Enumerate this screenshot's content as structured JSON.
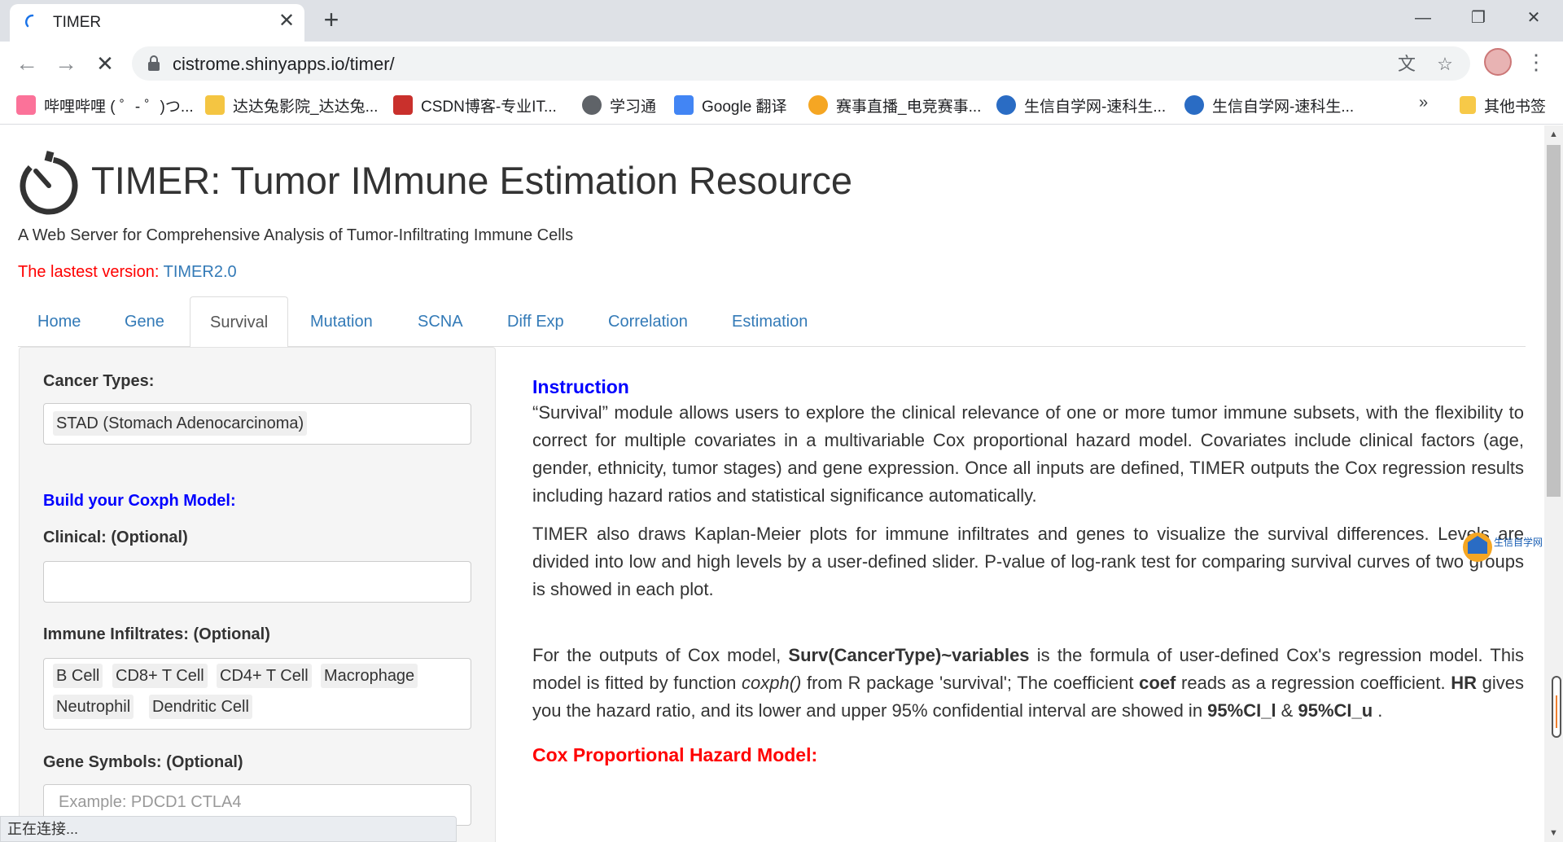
{
  "browser": {
    "tab_title": "TIMER",
    "tab_close": "✕",
    "new_tab": "+",
    "url": "cistrome.shinyapps.io/timer/",
    "win_minimize": "—",
    "win_restore": "❐",
    "win_close": "✕",
    "bookmarks": [
      {
        "label": "哔哩哔哩 ( ゜- ゜)つ...",
        "icon": "bilibili-icon",
        "color": "#fb7299"
      },
      {
        "label": "达达兔影院_达达兔...",
        "icon": "rabbit-icon",
        "color": "#f4c542"
      },
      {
        "label": "CSDN博客-专业IT...",
        "icon": "csdn-icon",
        "color": "#c9302c"
      },
      {
        "label": "学习通",
        "icon": "globe-icon",
        "color": "#5f6368"
      },
      {
        "label": "Google 翻译",
        "icon": "translate-icon",
        "color": "#4285f4"
      },
      {
        "label": "赛事直播_电竞赛事...",
        "icon": "fox-icon",
        "color": "#f5a623"
      },
      {
        "label": "生信自学网-速科生...",
        "icon": "biowolf-icon",
        "color": "#2a6cc4"
      },
      {
        "label": "生信自学网-速科生...",
        "icon": "biowolf-icon",
        "color": "#2a6cc4"
      }
    ],
    "bookmarks_more": "»",
    "other_bookmarks": "其他书签",
    "status_text": "正在连接..."
  },
  "page": {
    "title": "TIMER: Tumor IMmune Estimation Resource",
    "subtitle": "A Web Server for Comprehensive Analysis of Tumor-Infiltrating Immune Cells",
    "version_prefix": "The lastest version: ",
    "version_link": "TIMER2.0",
    "tabs": [
      "Home",
      "Gene",
      "Survival",
      "Mutation",
      "SCNA",
      "Diff Exp",
      "Correlation",
      "Estimation"
    ],
    "active_tab": "Survival"
  },
  "sidebar": {
    "cancer_label": "Cancer Types:",
    "cancer_value": "STAD (Stomach Adenocarcinoma)",
    "build_title": "Build your Coxph Model:",
    "clinical_label": "Clinical: (Optional)",
    "clinical_value": "",
    "immune_label": "Immune Infiltrates: (Optional)",
    "immune_chips": [
      "B Cell",
      "CD8+ T Cell",
      "CD4+ T Cell",
      "Macrophage",
      "Neutrophil",
      "Dendritic Cell"
    ],
    "gene_label": "Gene Symbols: (Optional)",
    "gene_placeholder": "Example: PDCD1 CTLA4"
  },
  "main": {
    "instruction_title": "Instruction",
    "para1": "“Survival” module allows users to explore the clinical relevance of one or more tumor immune subsets, with the flexibility to correct for multiple covariates in a multivariable Cox proportional hazard model. Covariates include clinical factors (age, gender, ethnicity, tumor stages) and gene expression. Once all inputs are defined, TIMER outputs the Cox regression results including hazard ratios and statistical significance automatically.",
    "para2": "TIMER also draws Kaplan-Meier plots for immune infiltrates and genes to visualize the survival differences. Levels are divided into low and high levels by a user-defined slider. P-value of log-rank test for comparing survival curves of two groups is showed in each plot.",
    "para3": {
      "t1": "For the outputs of Cox model, ",
      "b1": "Surv(CancerType)~variables",
      "t2": " is the formula of user-defined Cox's regression model. This model is fitted by function ",
      "i1": "coxph()",
      "t3": " from R package 'survival'; The coefficient ",
      "b2": "coef",
      "t4": " reads as a regression coefficient. ",
      "b3": "HR",
      "t5": " gives you the hazard ratio, and its lower and upper 95% confidential interval are showed in ",
      "b4": "95%CI_l",
      "t6": " & ",
      "b5": "95%CI_u",
      "t7": " ."
    },
    "cox_title": "Cox Proportional Hazard Model:"
  },
  "watermark": "生信自学网"
}
